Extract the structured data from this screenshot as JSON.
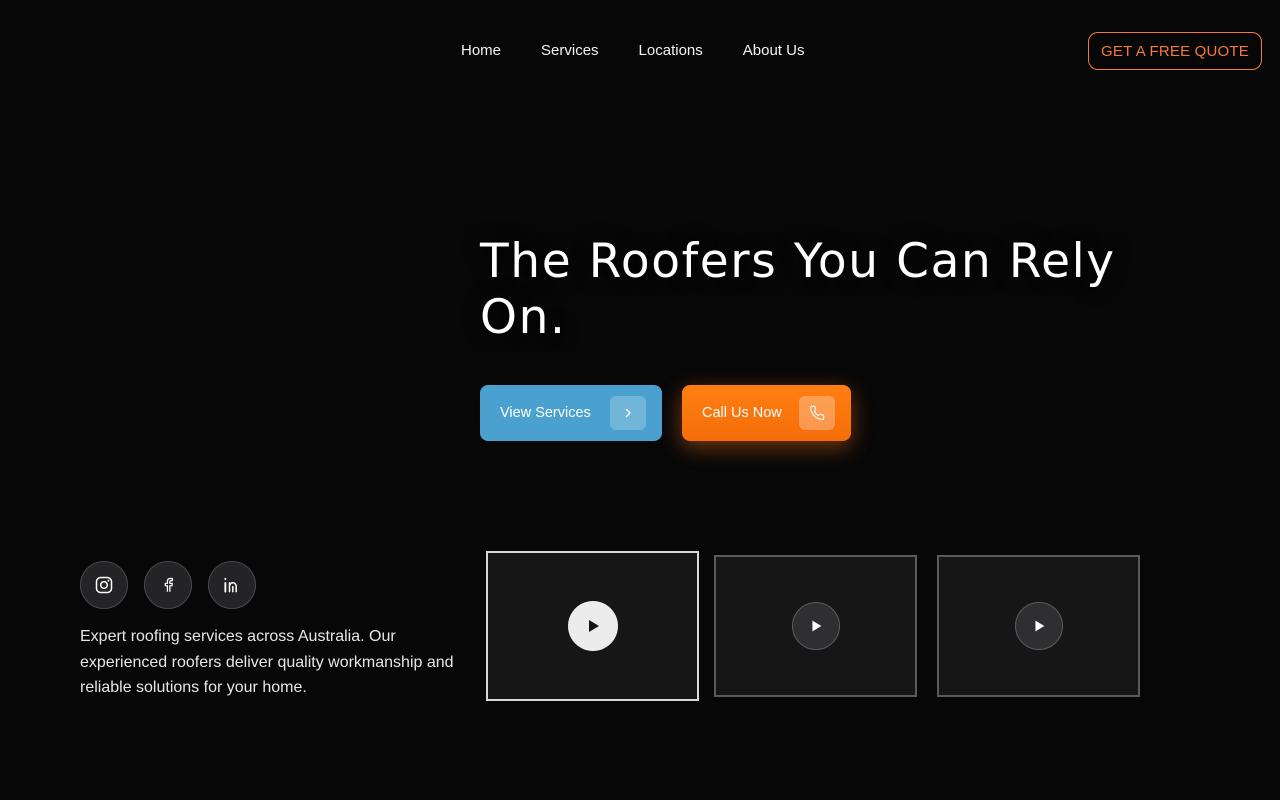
{
  "nav": {
    "links": [
      {
        "label": "Home"
      },
      {
        "label": "Services"
      },
      {
        "label": "Locations"
      },
      {
        "label": "About Us"
      }
    ],
    "quote_button": "GET A FREE QUOTE"
  },
  "hero": {
    "title": "The Roofers You Can Rely On.",
    "view_services": "View Services",
    "call_us": "Call Us Now"
  },
  "social": {
    "icons": [
      "instagram-icon",
      "facebook-icon",
      "linkedin-icon"
    ]
  },
  "blurb": "Expert roofing services across Australia. Our experienced roofers deliver quality workmanship and reliable solutions for your home.",
  "videos": {
    "count": 3,
    "active_index": 0
  },
  "colors": {
    "background": "#070708",
    "accent_orange": "#ff7f12",
    "accent_blue": "#4aa1cf",
    "quote_border": "#f47a3a"
  }
}
